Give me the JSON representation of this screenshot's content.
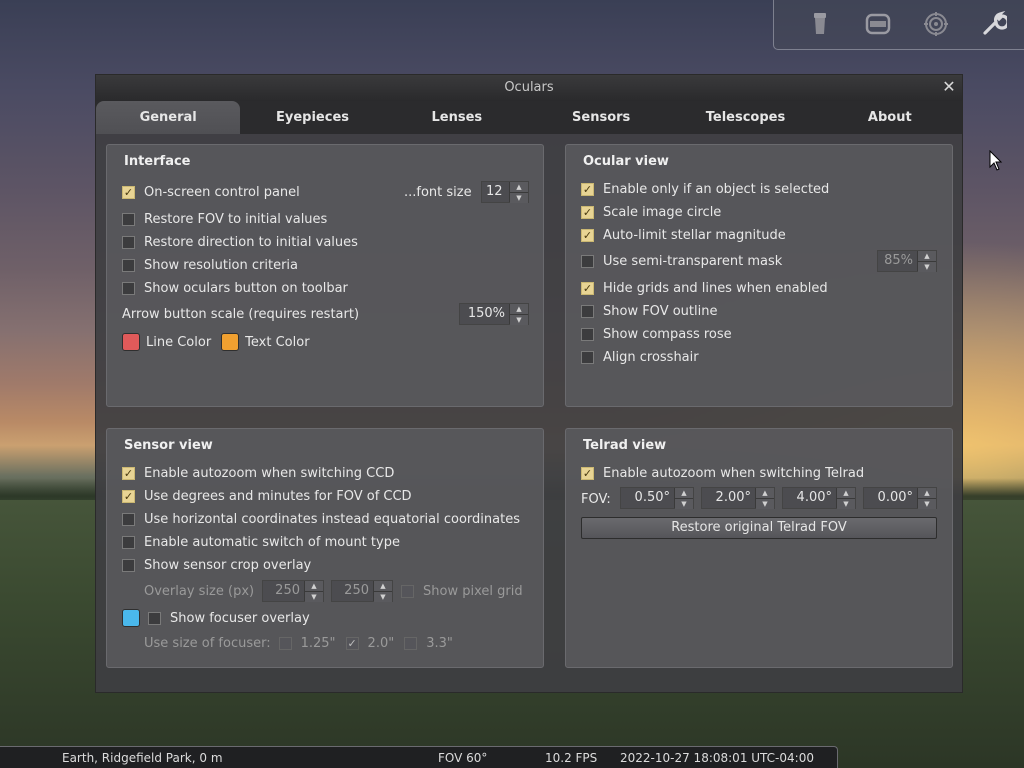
{
  "top_toolbar": {
    "buttons": [
      {
        "icon": "ocular-icon"
      },
      {
        "icon": "ccd-icon"
      },
      {
        "icon": "telrad-icon"
      },
      {
        "icon": "wrench-icon"
      }
    ]
  },
  "dialog": {
    "title": "Oculars",
    "close_label": "✕",
    "tabs": [
      "General",
      "Eyepieces",
      "Lenses",
      "Sensors",
      "Telescopes",
      "About"
    ],
    "active_tab": "General"
  },
  "interface": {
    "title": "Interface",
    "on_screen_panel": {
      "label": "On-screen control panel",
      "checked": true
    },
    "font_size_label": "...font size",
    "font_size": "12",
    "restore_fov": {
      "label": "Restore FOV to initial values",
      "checked": false
    },
    "restore_direction": {
      "label": "Restore direction to initial values",
      "checked": false
    },
    "show_resolution": {
      "label": "Show resolution criteria",
      "checked": false
    },
    "show_ocular_button": {
      "label": "Show oculars button on toolbar",
      "checked": false
    },
    "arrow_scale_label": "Arrow button scale (requires restart)",
    "arrow_scale": "150%",
    "line_color_label": "Line Color",
    "line_color": "#e05a5a",
    "text_color_label": "Text Color",
    "text_color": "#f0a030"
  },
  "ocular_view": {
    "title": "Ocular view",
    "enable_if_selected": {
      "label": "Enable only if an object is selected",
      "checked": true
    },
    "scale_image_circle": {
      "label": "Scale image circle",
      "checked": true
    },
    "auto_limit": {
      "label": "Auto-limit stellar magnitude",
      "checked": true
    },
    "semi_transparent": {
      "label": "Use semi-transparent mask",
      "checked": false
    },
    "mask_value": "85%",
    "hide_grids": {
      "label": "Hide grids and lines when enabled",
      "checked": true
    },
    "show_fov_outline": {
      "label": "Show FOV outline",
      "checked": false
    },
    "show_compass": {
      "label": "Show compass rose",
      "checked": false
    },
    "align_crosshair": {
      "label": "Align crosshair",
      "checked": false
    }
  },
  "sensor_view": {
    "title": "Sensor view",
    "autozoom_ccd": {
      "label": "Enable autozoom when switching CCD",
      "checked": true
    },
    "degrees_minutes": {
      "label": "Use degrees and minutes for FOV of CCD",
      "checked": true
    },
    "horizontal_coords": {
      "label": "Use horizontal coordinates instead equatorial coordinates",
      "checked": false
    },
    "auto_mount": {
      "label": "Enable automatic switch of mount type",
      "checked": false
    },
    "crop_overlay": {
      "label": "Show sensor crop overlay",
      "checked": false
    },
    "overlay_size_label": "Overlay size (px)",
    "overlay_w": "250",
    "overlay_h": "250",
    "pixel_grid": {
      "label": "Show pixel grid",
      "checked": false
    },
    "focuser_color": "#4ab8ec",
    "focuser_overlay": {
      "label": "Show focuser overlay",
      "checked": false
    },
    "focuser_size_label": "Use size of focuser:",
    "focuser_sizes": [
      {
        "label": "1.25\"",
        "checked": false
      },
      {
        "label": "2.0\"",
        "checked": true
      },
      {
        "label": "3.3\"",
        "checked": false
      }
    ]
  },
  "telrad_view": {
    "title": "Telrad view",
    "autozoom_telrad": {
      "label": "Enable autozoom when switching Telrad",
      "checked": true
    },
    "fov_label": "FOV:",
    "fov_values": [
      "0.50°",
      "2.00°",
      "4.00°",
      "0.00°"
    ],
    "restore_button": "Restore original Telrad FOV"
  },
  "status_bar": {
    "location": "Earth, Ridgefield Park, 0 m",
    "fov": "FOV 60°",
    "fps": "10.2 FPS",
    "datetime": "2022-10-27 18:08:01 UTC-04:00"
  }
}
